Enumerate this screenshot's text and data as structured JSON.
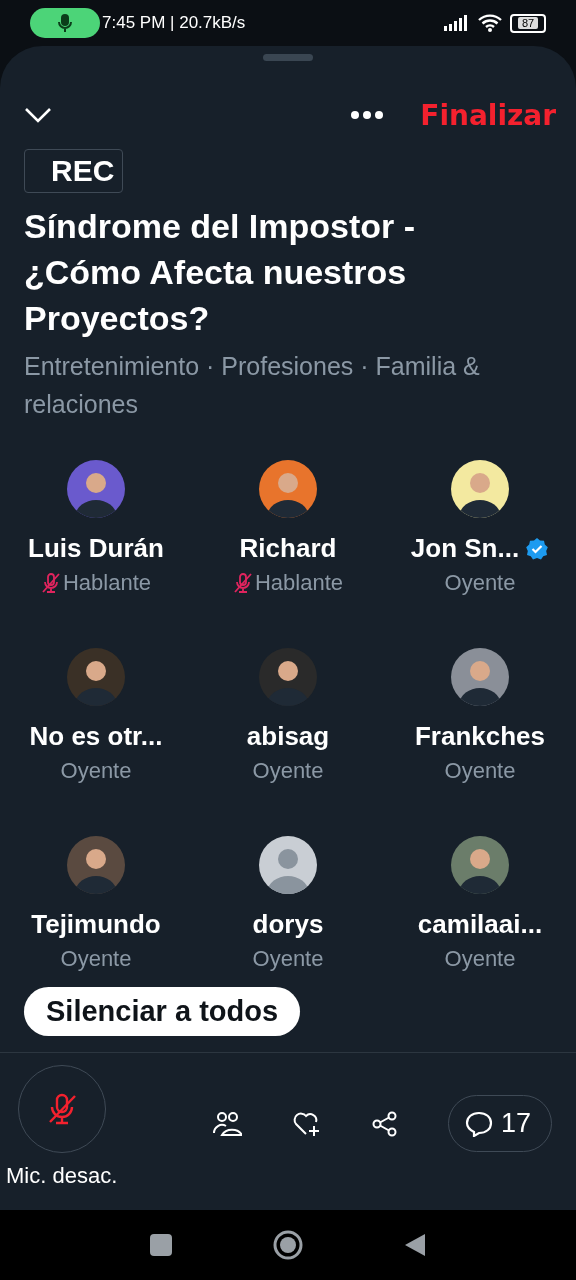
{
  "status_bar": {
    "time": "7:45 PM | 20.7kB/s",
    "battery": "87"
  },
  "header": {
    "end_button": "Finalizar",
    "rec_label": "REC"
  },
  "space": {
    "title": "Síndrome del Impostor - ¿Cómo Afecta nuestros Proyectos?",
    "topics": "Entretenimiento · Profesiones · Familia & relaciones"
  },
  "participants": [
    {
      "name": "Luis Durán",
      "role": "Hablante",
      "muted": true,
      "verified": false,
      "kind": "photo"
    },
    {
      "name": "Richard",
      "role": "Hablante",
      "muted": true,
      "verified": false,
      "kind": "photo"
    },
    {
      "name": "Jon Sn...",
      "role": "Oyente",
      "muted": false,
      "verified": true,
      "kind": "photo"
    },
    {
      "name": "No es otr...",
      "role": "Oyente",
      "muted": false,
      "verified": false,
      "kind": "photo"
    },
    {
      "name": "abisag",
      "role": "Oyente",
      "muted": false,
      "verified": false,
      "kind": "photo"
    },
    {
      "name": "Frankches",
      "role": "Oyente",
      "muted": false,
      "verified": false,
      "kind": "photo"
    },
    {
      "name": "Tejimundo",
      "role": "Oyente",
      "muted": false,
      "verified": false,
      "kind": "photo"
    },
    {
      "name": "dorys",
      "role": "Oyente",
      "muted": false,
      "verified": false,
      "kind": "default"
    },
    {
      "name": "camilaai...",
      "role": "Oyente",
      "muted": false,
      "verified": false,
      "kind": "photo"
    }
  ],
  "mute_all_button": "Silenciar a todos",
  "bottom_bar": {
    "mic_label": "Mic. desac.",
    "mic_muted": true,
    "comments_count": "17"
  }
}
